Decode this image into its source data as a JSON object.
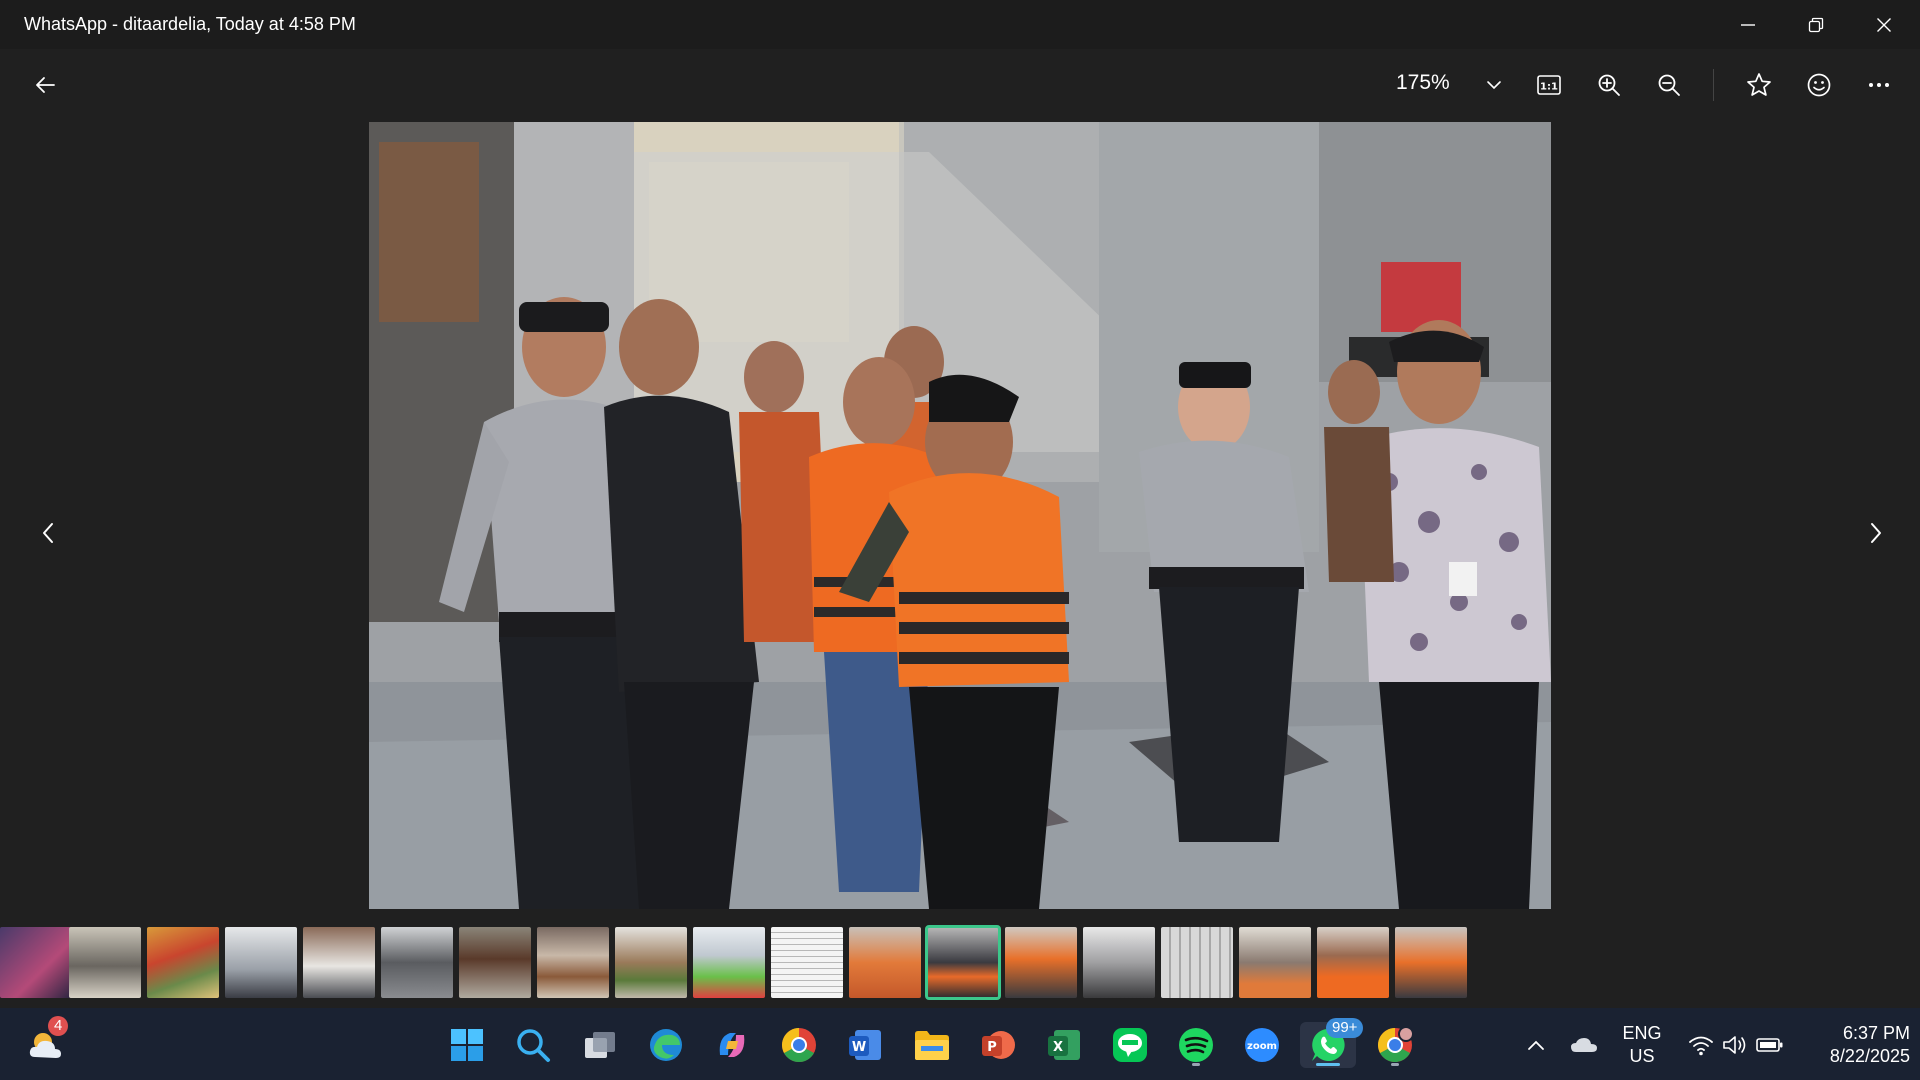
{
  "window": {
    "title": "WhatsApp - ditaardelia, Today at 4:58 PM"
  },
  "toolbar": {
    "zoom_level": "175%"
  },
  "taskbar": {
    "weather_badge": "4",
    "whatsapp_badge": "99+",
    "zoom_app_label": "zoom",
    "language_line1": "ENG",
    "language_line2": "US",
    "time": "6:37 PM",
    "date": "8/22/2025"
  },
  "colors": {
    "accent_selected": "#3cc78b",
    "taskbar_bg": "#1a2232",
    "viewer_bg": "#202020"
  }
}
